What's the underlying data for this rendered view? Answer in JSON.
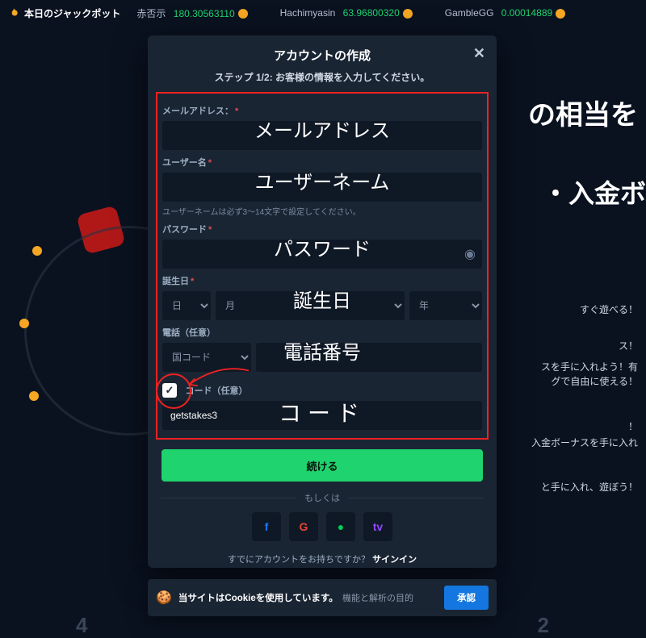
{
  "topbar": {
    "jackpot_label": "本日のジャックポット",
    "ticker": [
      {
        "name": "赤否示",
        "value": "180.30563110"
      },
      {
        "name": "Hachimyasin",
        "value": "63.96800320"
      },
      {
        "name": "GambleGG",
        "value": "0.00014889"
      }
    ]
  },
  "bg": {
    "title_line1": "の相当を",
    "title_line2": "・入金ボ",
    "line3": "すぐ遊べる！",
    "line4": "ス！",
    "line5a": "スを手に入れよう！有",
    "line5b": "グで自由に使える！",
    "line6": "！",
    "line7a": "入金ボーナスを手に入れ",
    "line8": "と手に入れ、遊ぼう！"
  },
  "modal": {
    "title": "アカウントの作成",
    "subtitle": "ステップ 1/2: お客様の情報を入力してください。",
    "email_label": "メールアドレス：",
    "user_label": "ユーザー名",
    "user_hint": "ユーザーネームは必ず3～14文字で設定してください。",
    "password_label": "パスワード",
    "dob_label": "誕生日",
    "dob_day": "日",
    "dob_month": "月",
    "dob_year": "年",
    "phone_label": "電話（任意）",
    "phone_cc": "国コード",
    "code_label": "コード（任意）",
    "code_value": "getstakes3",
    "continue": "続ける",
    "or": "もしくは",
    "already": "すでにアカウントをお持ちですか？",
    "signin": "サインイン",
    "social": {
      "fb": "f",
      "google": "G",
      "line": "●",
      "twitch": "tv"
    }
  },
  "annotations": {
    "email": "メールアドレス",
    "username": "ユーザーネーム",
    "password": "パスワード",
    "dob": "誕生日",
    "phone": "電話番号",
    "code": "コード"
  },
  "cookie": {
    "main": "当サイトはCookieを使用しています。",
    "sub": "機能と解析の目的",
    "accept": "承認"
  }
}
